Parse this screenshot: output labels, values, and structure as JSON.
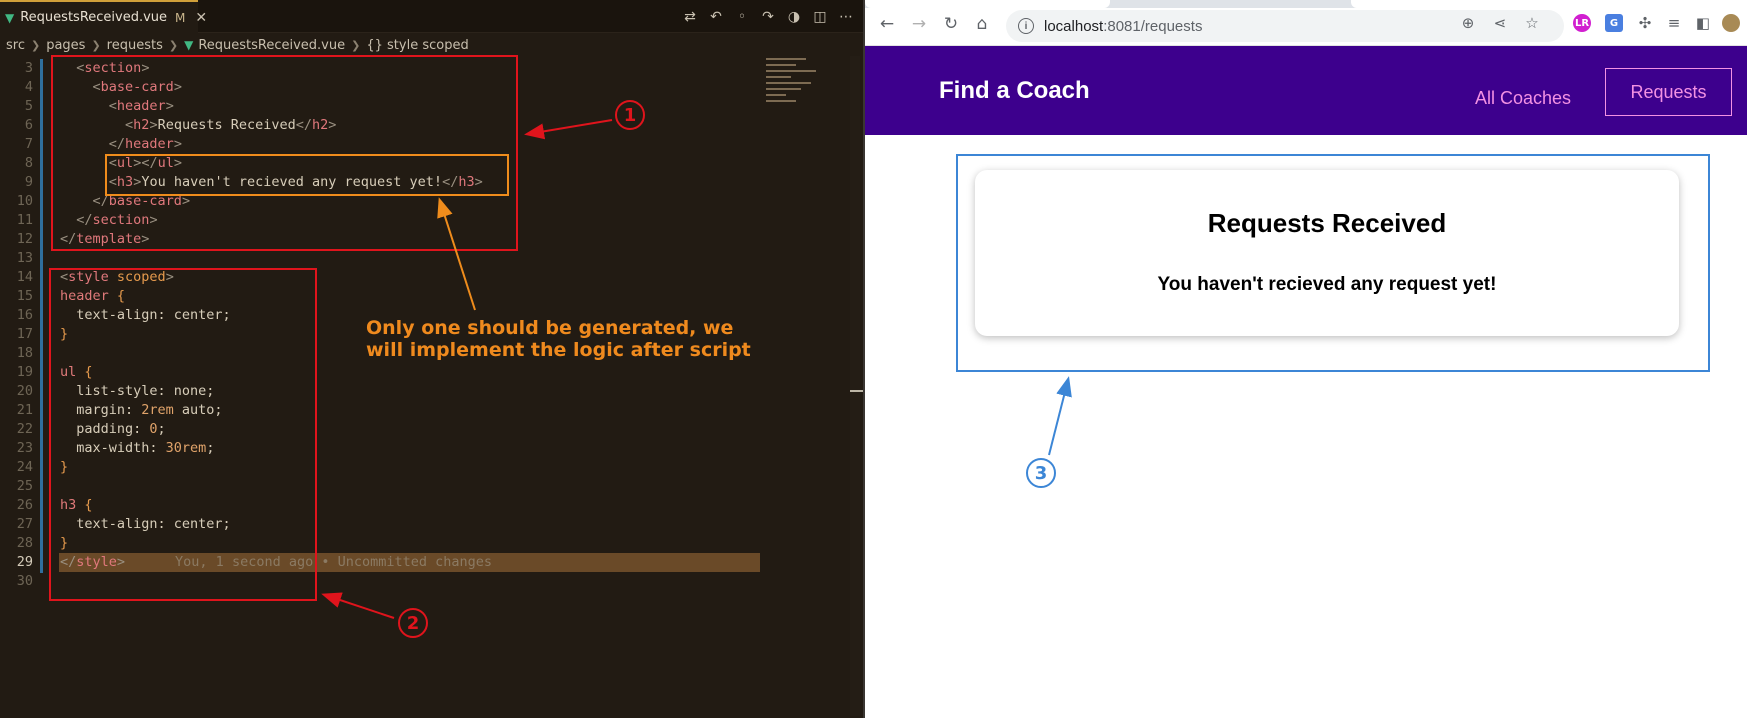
{
  "editor": {
    "tab": {
      "filename": "RequestsReceived.vue",
      "modified": "M",
      "close": "✕"
    },
    "breadcrumb": [
      "src",
      "pages",
      "requests",
      "RequestsReceived.vue",
      "{} style scoped"
    ],
    "lines": [
      {
        "n": "3",
        "html": "  <span class='p'>&lt;</span><span class='t'>section</span><span class='p'>&gt;</span>"
      },
      {
        "n": "4",
        "html": "    <span class='p'>&lt;</span><span class='t'>base-card</span><span class='p'>&gt;</span>"
      },
      {
        "n": "5",
        "html": "      <span class='p'>&lt;</span><span class='t'>header</span><span class='p'>&gt;</span>"
      },
      {
        "n": "6",
        "html": "        <span class='p'>&lt;</span><span class='t'>h2</span><span class='p'>&gt;</span>Requests Received<span class='p'>&lt;/</span><span class='t'>h2</span><span class='p'>&gt;</span>"
      },
      {
        "n": "7",
        "html": "      <span class='p'>&lt;/</span><span class='t'>header</span><span class='p'>&gt;</span>"
      },
      {
        "n": "8",
        "html": "      <span class='p'>&lt;</span><span class='t'>ul</span><span class='p'>&gt;&lt;/</span><span class='t'>ul</span><span class='p'>&gt;</span>"
      },
      {
        "n": "9",
        "html": "      <span class='p'>&lt;</span><span class='t'>h3</span><span class='p'>&gt;</span>You haven't recieved any request yet!<span class='p'>&lt;/</span><span class='t'>h3</span><span class='p'>&gt;</span>"
      },
      {
        "n": "10",
        "html": "    <span class='p'>&lt;/</span><span class='t'>base-card</span><span class='p'>&gt;</span>"
      },
      {
        "n": "11",
        "html": "  <span class='p'>&lt;/</span><span class='t'>section</span><span class='p'>&gt;</span>"
      },
      {
        "n": "12",
        "html": "<span class='p'>&lt;/</span><span class='t'>template</span><span class='p'>&gt;</span>"
      },
      {
        "n": "13",
        "html": ""
      },
      {
        "n": "14",
        "html": "<span class='p'>&lt;</span><span class='t'>style</span> <span class='kw'>scoped</span><span class='p'>&gt;</span>"
      },
      {
        "n": "15",
        "html": "<span class='sel'>header</span> <span class='kw'>{</span>"
      },
      {
        "n": "16",
        "html": "  text-align: center;"
      },
      {
        "n": "17",
        "html": "<span class='kw'>}</span>"
      },
      {
        "n": "18",
        "html": ""
      },
      {
        "n": "19",
        "html": "<span class='sel'>ul</span> <span class='kw'>{</span>"
      },
      {
        "n": "20",
        "html": "  list-style: none;"
      },
      {
        "n": "21",
        "html": "  margin: <span class='num'>2rem</span> auto;"
      },
      {
        "n": "22",
        "html": "  padding: <span class='num'>0</span>;"
      },
      {
        "n": "23",
        "html": "  max-width: <span class='num'>30rem</span>;"
      },
      {
        "n": "24",
        "html": "<span class='kw'>}</span>"
      },
      {
        "n": "25",
        "html": ""
      },
      {
        "n": "26",
        "html": "<span class='sel'>h3</span> <span class='kw'>{</span>"
      },
      {
        "n": "27",
        "html": "  text-align: center;"
      },
      {
        "n": "28",
        "html": "<span class='kw'>}</span>"
      },
      {
        "n": "29",
        "html": "<span class='p'>&lt;/</span><span class='t'>style</span><span class='p'>&gt;</span>"
      },
      {
        "n": "30",
        "html": ""
      }
    ],
    "blame": "You, 1 second ago • Uncommitted changes",
    "active_line": "29"
  },
  "annotations": {
    "label_1": "1",
    "label_2": "2",
    "label_3": "3",
    "note": "Only one should be generated, we will implement the logic after script",
    "colors": {
      "red": "#e0141c",
      "orange": "#ef8c1c",
      "blue": "#3c86d6"
    }
  },
  "browser": {
    "url_host": "localhost",
    "url_path": ":8081/requests",
    "site_title": "Find a Coach",
    "nav_all": "All Coaches",
    "nav_requests": "Requests",
    "card_title": "Requests Received",
    "card_message": "You haven't recieved any request yet!",
    "colors": {
      "header_bg": "#3d008d",
      "nav_link": "#f391e3"
    }
  }
}
